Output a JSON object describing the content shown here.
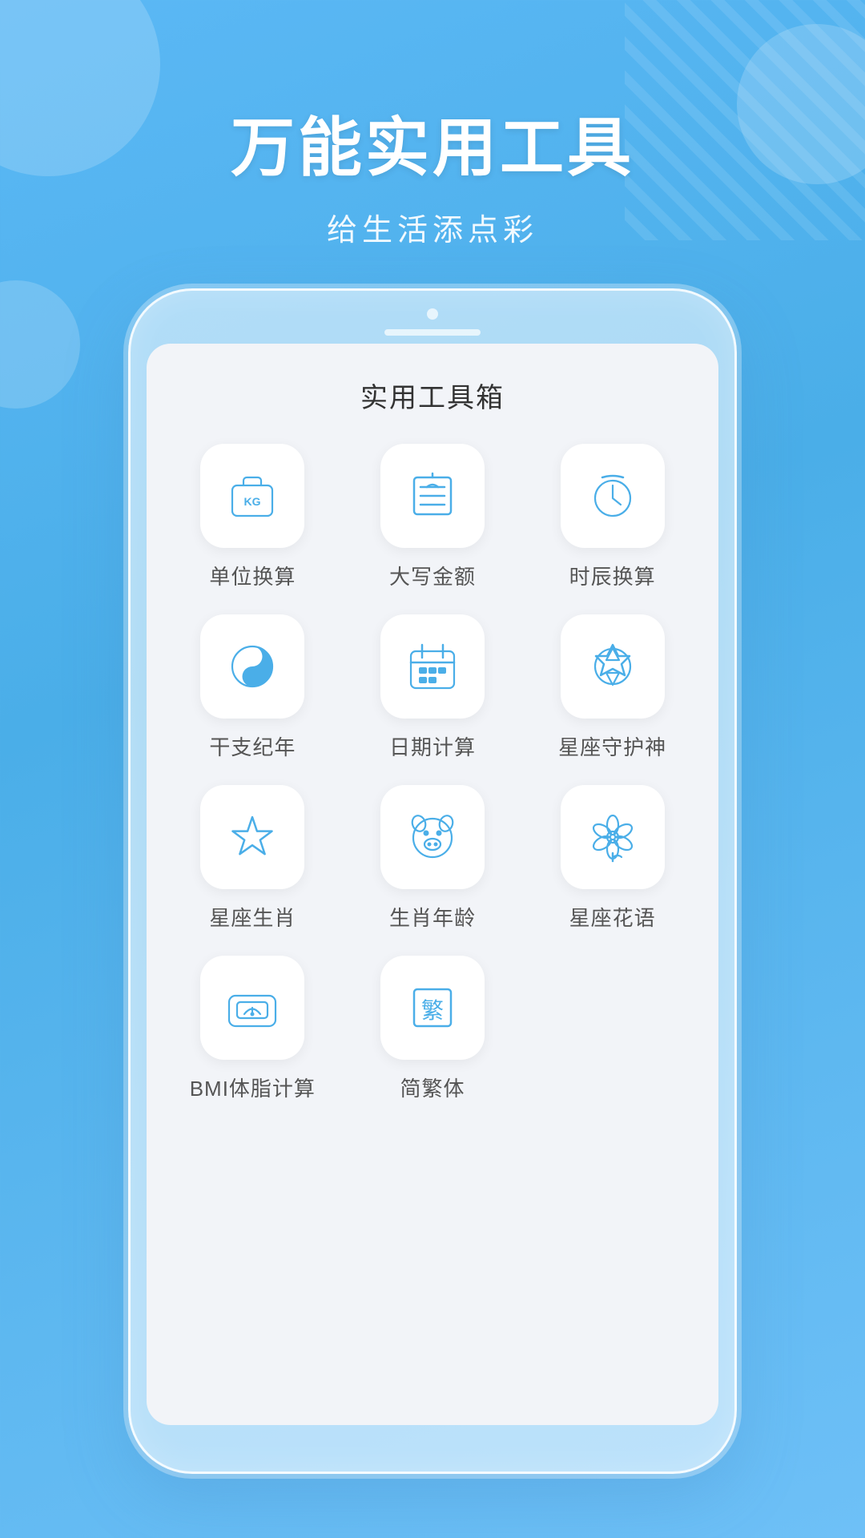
{
  "header": {
    "title": "万能实用工具",
    "subtitle": "给生活添点彩"
  },
  "screen": {
    "title": "实用工具箱"
  },
  "tools": [
    {
      "id": "unit-convert",
      "label": "单位换算",
      "icon": "unit"
    },
    {
      "id": "capital-amount",
      "label": "大写金额",
      "icon": "capital"
    },
    {
      "id": "time-convert",
      "label": "时辰换算",
      "icon": "time"
    },
    {
      "id": "ganzhi",
      "label": "干支纪年",
      "icon": "ganzhi"
    },
    {
      "id": "date-calc",
      "label": "日期计算",
      "icon": "date"
    },
    {
      "id": "constellation-guardian",
      "label": "星座守护神",
      "icon": "star6"
    },
    {
      "id": "constellation-zodiac",
      "label": "星座生肖",
      "icon": "star5"
    },
    {
      "id": "zodiac-age",
      "label": "生肖年龄",
      "icon": "pig"
    },
    {
      "id": "constellation-flower",
      "label": "星座花语",
      "icon": "flower"
    },
    {
      "id": "bmi",
      "label": "BMI体脂计算",
      "icon": "bmi"
    },
    {
      "id": "simp-trad",
      "label": "简繁体",
      "icon": "trad"
    }
  ]
}
